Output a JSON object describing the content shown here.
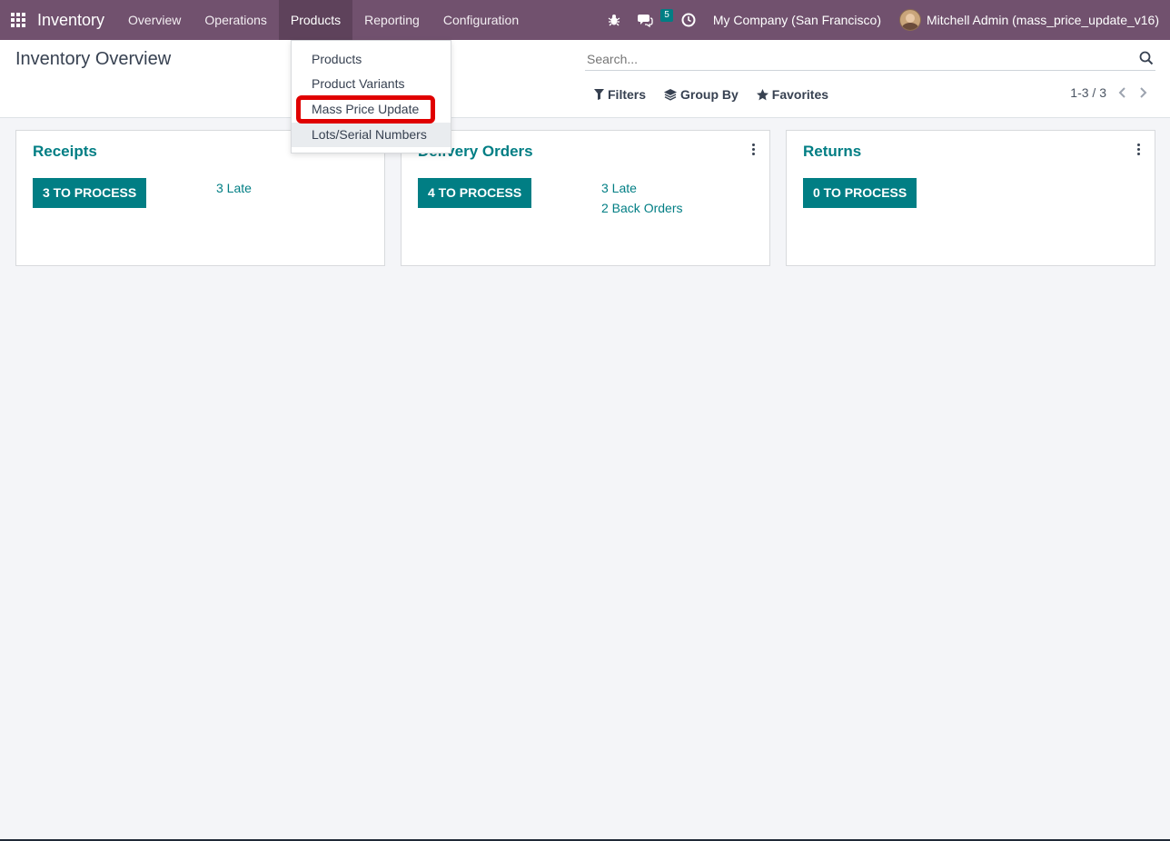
{
  "navbar": {
    "app_name": "Inventory",
    "menu": [
      {
        "label": "Overview"
      },
      {
        "label": "Operations"
      },
      {
        "label": "Products"
      },
      {
        "label": "Reporting"
      },
      {
        "label": "Configuration"
      }
    ],
    "active_menu": "Products",
    "messages_count": "5",
    "company": "My Company (San Francisco)",
    "user": "Mitchell Admin (mass_price_update_v16)",
    "color": "#71516e"
  },
  "control_panel": {
    "title": "Inventory Overview",
    "search_placeholder": "Search...",
    "filters_label": "Filters",
    "group_by_label": "Group By",
    "favorites_label": "Favorites",
    "pager": "1-3 / 3"
  },
  "dropdown": {
    "items": [
      {
        "label": "Products"
      },
      {
        "label": "Product Variants"
      },
      {
        "label": "Mass Price Update"
      },
      {
        "label": "Lots/Serial Numbers"
      }
    ],
    "highlighted": "Mass Price Update",
    "hovered": "Lots/Serial Numbers"
  },
  "cards": [
    {
      "title": "Receipts",
      "button": "3 TO PROCESS",
      "links": [
        "3 Late"
      ]
    },
    {
      "title": "Delivery Orders",
      "button": "4 TO PROCESS",
      "links": [
        "3 Late",
        "2 Back Orders"
      ]
    },
    {
      "title": "Returns",
      "button": "0 TO PROCESS",
      "links": []
    }
  ],
  "colors": {
    "accent": "#017e84",
    "highlight": "#e00000"
  }
}
